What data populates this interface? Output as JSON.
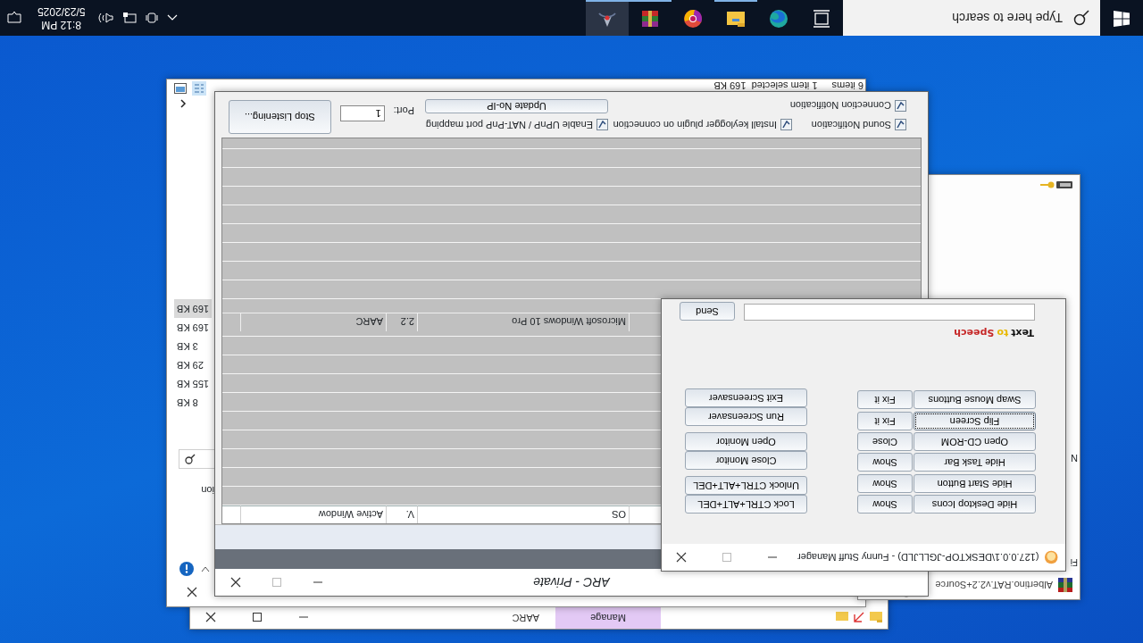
{
  "flipped": true,
  "back_window": {
    "title": "AARC",
    "ribbon_tab": "Manage"
  },
  "explorer": {
    "column_header": "ion",
    "sizes": [
      {
        "text": "8 KB",
        "selected": false
      },
      {
        "text": "155 KB",
        "selected": false
      },
      {
        "text": "29 KB",
        "selected": false
      },
      {
        "text": "3 KB",
        "selected": false
      },
      {
        "text": "169 KB",
        "selected": false
      },
      {
        "text": "169 KB",
        "selected": true
      }
    ],
    "status": [
      "6 items",
      "1 item selected  169 KB"
    ]
  },
  "archive_window": {
    "title": "Albertino.RAT.v2.2+Source",
    "labels": [
      "Fi",
      "N"
    ]
  },
  "arc": {
    "title": "ARC - Private",
    "columns": [
      "OS",
      "V.",
      "Active Window"
    ],
    "clients": [
      {
        "os": "Microsoft Windows 10 Pro",
        "version": "2.2",
        "active_window": "AARC"
      }
    ],
    "options": [
      {
        "label": "Sound Notification",
        "checked": true
      },
      {
        "label": "Connection Notification",
        "checked": true
      },
      {
        "label": "Install keylogger plugin on connection",
        "checked": true
      },
      {
        "label": "Enable UPnP / NAT-PnP port mapping",
        "checked": true
      }
    ],
    "update_button": "Update No-IP",
    "port": {
      "label": "Port:",
      "value": "1"
    },
    "listen_button": "Stop Listening..."
  },
  "manager": {
    "title": "(127.0.0.1\\DESKTOP-JGLLJLD) - Funny Stuff Manager",
    "pairs": [
      {
        "action": "Hide Desktop Icons",
        "undo": "Show",
        "focused": false
      },
      {
        "action": "Hide Start Button",
        "undo": "Show",
        "focused": false
      },
      {
        "action": "Hide Task Bar",
        "undo": "Show",
        "focused": false
      },
      {
        "action": "Open CD-ROM",
        "undo": "Close",
        "focused": false
      },
      {
        "action": "Flip Screen",
        "undo": "Fix it",
        "focused": true
      },
      {
        "action": "Swap Mouse Buttons",
        "undo": "Fix it",
        "focused": false
      }
    ],
    "system_buttons": [
      [
        "Lock CTRL+ALT+DEL",
        "Unlock CTRL+ALT+DEL"
      ],
      [
        "Close Monitor",
        "Open Monitor"
      ],
      [
        "Run Screensaver",
        "Exit Screensaver"
      ]
    ],
    "tts": {
      "logo": [
        {
          "text": "Text",
          "color": "#111111"
        },
        {
          "text": "to",
          "color": "#e8b800"
        },
        {
          "text": "Speech",
          "color": "#c62828"
        }
      ],
      "send": "Send"
    }
  },
  "taskbar": {
    "search": {
      "placeholder": "Type here to search"
    },
    "apps": [
      {
        "kind": "taskview",
        "running": false,
        "selected": false
      },
      {
        "kind": "edge",
        "running": false,
        "selected": false
      },
      {
        "kind": "explorer",
        "running": true,
        "selected": false
      },
      {
        "kind": "chrome",
        "running": false,
        "selected": false
      },
      {
        "kind": "winrar",
        "running": true,
        "selected": false
      },
      {
        "kind": "rat",
        "running": true,
        "selected": true
      }
    ],
    "clock": {
      "time": "8:12 PM",
      "date": "5/23/2025"
    }
  }
}
